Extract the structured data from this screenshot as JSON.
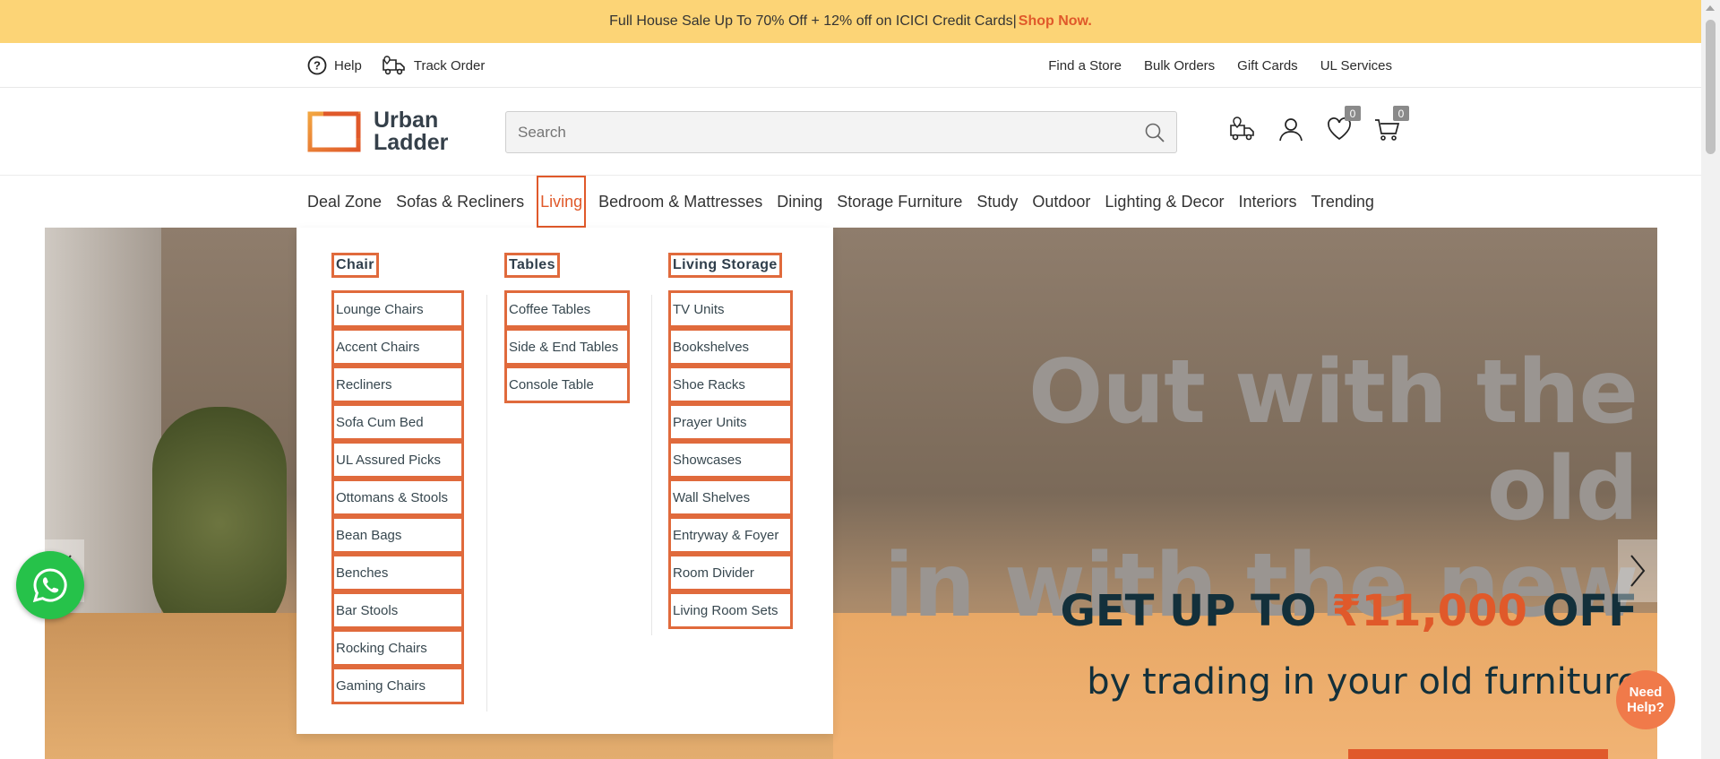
{
  "promo": {
    "text": "Full House Sale Up To 70% Off + 12% off on ICICI Credit Cards|",
    "link": "Shop Now."
  },
  "util": {
    "left": [
      {
        "label": "Help",
        "icon": "help-icon"
      },
      {
        "label": "Track Order",
        "icon": "truck-icon"
      }
    ],
    "right": [
      "Find a Store",
      "Bulk Orders",
      "Gift Cards",
      "UL Services"
    ]
  },
  "header": {
    "logo_line1": "Urban",
    "logo_line2": "Ladder",
    "search_placeholder": "Search",
    "wishlist_count": "0",
    "cart_count": "0"
  },
  "nav": [
    "Deal Zone",
    "Sofas & Recliners",
    "Living",
    "Bedroom & Mattresses",
    "Dining",
    "Storage Furniture",
    "Study",
    "Outdoor",
    "Lighting & Decor",
    "Interiors",
    "Trending"
  ],
  "dropdown": {
    "chair": {
      "title": "Chair",
      "items": [
        "Lounge Chairs",
        "Accent Chairs",
        "Recliners",
        "Sofa Cum Bed",
        "UL Assured Picks",
        "Ottomans & Stools",
        "Bean Bags",
        "Benches",
        "Bar Stools",
        "Rocking Chairs",
        "Gaming Chairs"
      ]
    },
    "tables": {
      "title": "Tables",
      "items": [
        "Coffee Tables",
        "Side & End Tables",
        "Console Table"
      ]
    },
    "storage": {
      "title": "Living Storage",
      "items": [
        "TV Units",
        "Bookshelves",
        "Shoe Racks",
        "Prayer Units",
        "Showcases",
        "Wall Shelves",
        "Entryway & Foyer",
        "Room Divider",
        "Living Room Sets"
      ]
    }
  },
  "hero": {
    "headline_line1": "Out with the old",
    "headline_line2": "in with the new",
    "offer_pre": "GET UP TO",
    "offer_amount": "₹11,000",
    "offer_post": "OFF",
    "offer_sub": "by trading in your old furniture"
  },
  "help_bubble": {
    "line1": "Need",
    "line2": "Help?"
  },
  "colors": {
    "accent": "#e0592a",
    "promo_bg": "#fcd476",
    "text_dark": "#13303b"
  }
}
